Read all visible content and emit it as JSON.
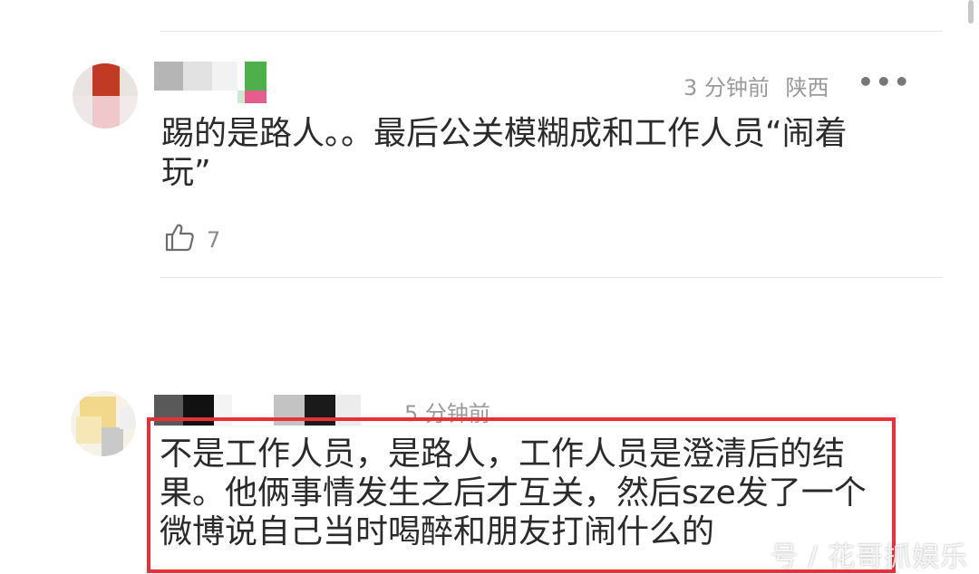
{
  "comments": [
    {
      "time": "3 分钟前",
      "location": "陕西",
      "more_icon": "more-dots-icon",
      "text": "踢的是路人。。最后公关模糊成和工作人员“闹着玩”",
      "likes": "7"
    },
    {
      "time": "5 分钟前",
      "text": "不是工作人员，是路人，工作人员是澄清后的结果。他俩事情发生之后才互关，然后sze发了一个微博说自己当时喝醉和朋友打闹什么的",
      "highlight_color": "#e8303a"
    }
  ],
  "watermark": "号 / 花哥抓娱乐"
}
